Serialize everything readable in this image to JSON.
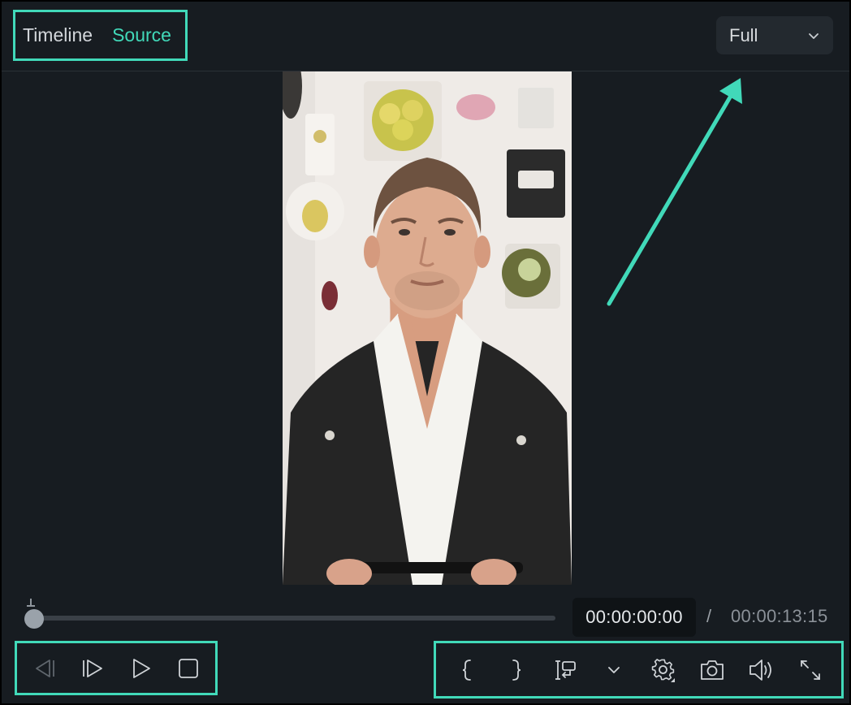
{
  "tabs": {
    "timeline": "Timeline",
    "source": "Source",
    "active": "Source"
  },
  "view_select": {
    "value": "Full"
  },
  "playback": {
    "current_time": "00:00:00:00",
    "separator": "/",
    "total_time": "00:00:13:15",
    "progress": 0
  },
  "colors": {
    "accent": "#41d9b9",
    "background": "#171c21"
  },
  "icons": {
    "left": [
      "previous-frame-icon",
      "next-frame-icon",
      "play-icon",
      "stop-icon"
    ],
    "right": [
      "mark-in-icon",
      "mark-out-icon",
      "insert-clip-icon",
      "chevron-down-icon",
      "settings-icon",
      "snapshot-icon",
      "volume-icon",
      "fullscreen-icon"
    ]
  }
}
